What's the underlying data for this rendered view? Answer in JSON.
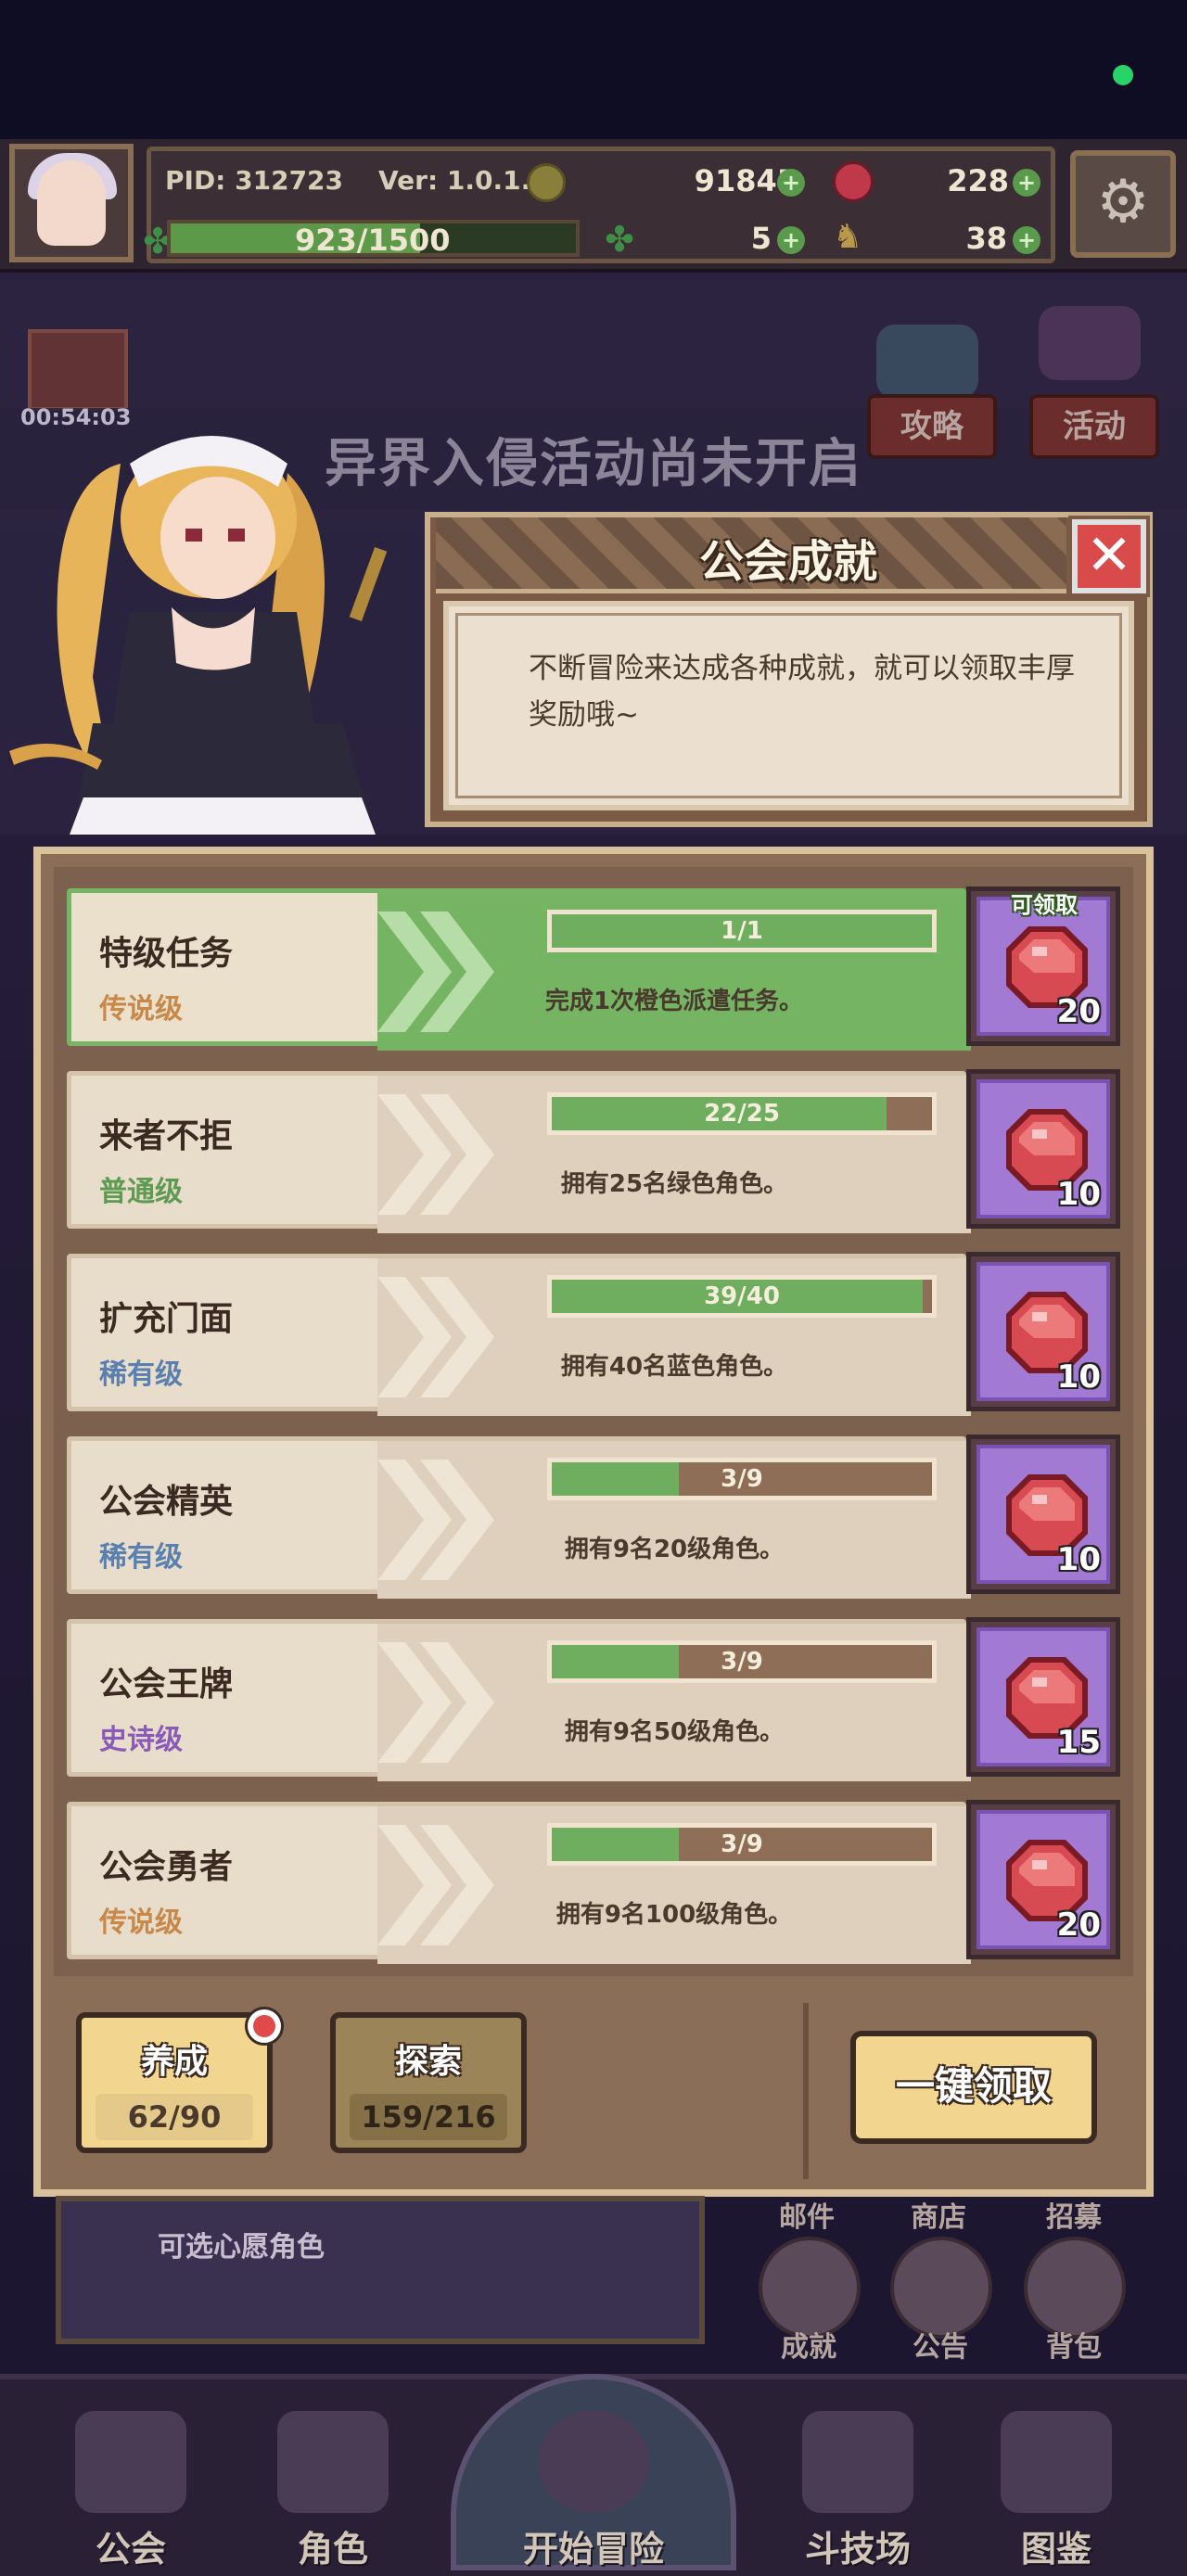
{
  "hud": {
    "pid": "PID: 312723",
    "version": "Ver: 1.0.1.0",
    "gold": "91845",
    "gems": "228",
    "xp": "923/1500",
    "xp_fraction": 0.615,
    "clover": "5",
    "keys": "38"
  },
  "event": {
    "timer": "00:54:03",
    "banner": "异界入侵活动尚未开启",
    "guide_label": "攻略",
    "activity_label": "活动"
  },
  "dialog": {
    "title": "公会成就",
    "close_icon": "close-icon",
    "description": "不断冒险来达成各种成就，就可以领取丰厚奖励哦~"
  },
  "achievements": [
    {
      "name": "特级任务",
      "rank": "传说级",
      "rank_color": "#c8884a",
      "progress": "1/1",
      "fraction": 1.0,
      "desc": "完成1次橙色派遣任务。",
      "reward": "20",
      "claimable": true,
      "claim_label": "可领取"
    },
    {
      "name": "来者不拒",
      "rank": "普通级",
      "rank_color": "#5e9a52",
      "progress": "22/25",
      "fraction": 0.88,
      "desc": "拥有25名绿色角色。",
      "reward": "10",
      "claimable": false
    },
    {
      "name": "扩充门面",
      "rank": "稀有级",
      "rank_color": "#5a80b0",
      "progress": "39/40",
      "fraction": 0.975,
      "desc": "拥有40名蓝色角色。",
      "reward": "10",
      "claimable": false
    },
    {
      "name": "公会精英",
      "rank": "稀有级",
      "rank_color": "#5a80b0",
      "progress": "3/9",
      "fraction": 0.333,
      "desc": "拥有9名20级角色。",
      "reward": "10",
      "claimable": false
    },
    {
      "name": "公会王牌",
      "rank": "史诗级",
      "rank_color": "#8a5ab8",
      "progress": "3/9",
      "fraction": 0.333,
      "desc": "拥有9名50级角色。",
      "reward": "15",
      "claimable": false
    },
    {
      "name": "公会勇者",
      "rank": "传说级",
      "rank_color": "#c8884a",
      "progress": "3/9",
      "fraction": 0.333,
      "desc": "拥有9名100级角色。",
      "reward": "20",
      "claimable": false
    }
  ],
  "tabs": [
    {
      "label": "养成",
      "count": "62/90",
      "active": true
    },
    {
      "label": "探索",
      "count": "159/216",
      "active": false
    }
  ],
  "claim_all_label": "一键领取",
  "background": {
    "wish_text": "可选心愿角色",
    "mail": "邮件",
    "shop": "商店",
    "recruit": "招募",
    "achievement": "成就",
    "notice": "公告",
    "bag": "背包"
  },
  "nav": [
    {
      "label": "公会"
    },
    {
      "label": "角色"
    },
    {
      "label": "开始冒险"
    },
    {
      "label": "斗技场"
    },
    {
      "label": "图鉴"
    }
  ]
}
